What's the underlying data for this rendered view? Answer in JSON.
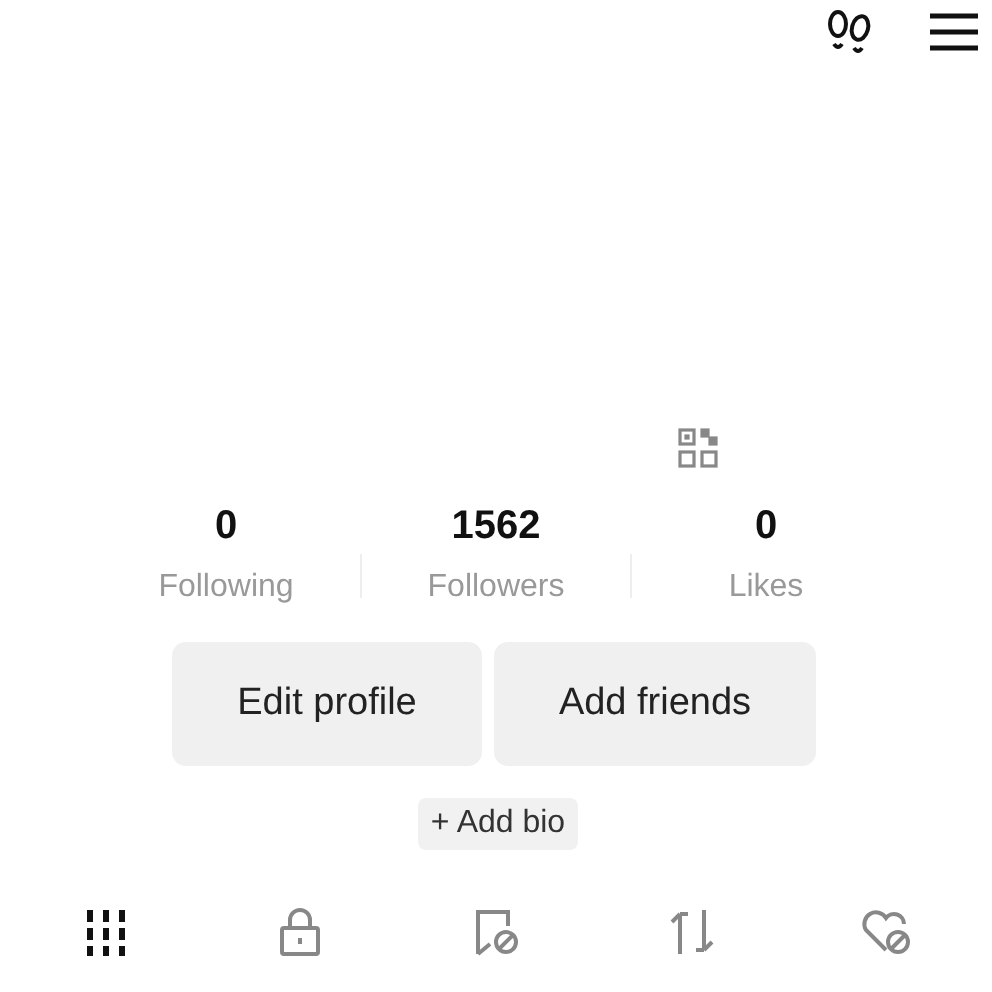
{
  "stats": [
    {
      "value": "0",
      "label": "Following"
    },
    {
      "value": "1562",
      "label": "Followers"
    },
    {
      "value": "0",
      "label": "Likes"
    }
  ],
  "buttons": [
    "Edit profile",
    "Add friends"
  ],
  "add_bio": "+ Add bio",
  "tabs": [
    {
      "kind": "grid",
      "selected": true
    },
    {
      "kind": "lock",
      "selected": false
    },
    {
      "kind": "saved",
      "selected": false
    },
    {
      "kind": "repost",
      "selected": false
    },
    {
      "kind": "liked",
      "selected": false
    }
  ]
}
